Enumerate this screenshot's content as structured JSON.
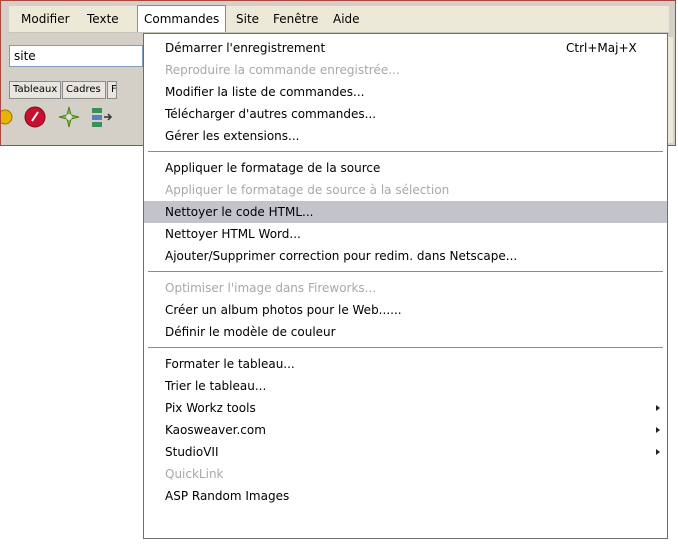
{
  "menubar": {
    "items": [
      {
        "label": "Modifier"
      },
      {
        "label": "Texte"
      },
      {
        "label": "Commandes"
      },
      {
        "label": "Site"
      },
      {
        "label": "Fenêtre"
      },
      {
        "label": "Aide"
      }
    ]
  },
  "site_selector": {
    "value": "site"
  },
  "panel_tabs": [
    {
      "label": "Tableaux"
    },
    {
      "label": "Cadres"
    },
    {
      "label": "F"
    }
  ],
  "colors": {
    "menu_selected_bg": "#c3c3cc",
    "disabled_text": "#a8a8a8",
    "frame_border": "#b0453d"
  },
  "commands_menu": {
    "items": [
      {
        "label": "Démarrer l'enregistrement",
        "shortcut": "Ctrl+Maj+X"
      },
      {
        "label": "Reproduire la commande enregistrée...",
        "disabled": true
      },
      {
        "label": "Modifier la liste de commandes..."
      },
      {
        "label": "Télécharger d'autres commandes..."
      },
      {
        "label": "Gérer les extensions..."
      },
      {
        "separator": true
      },
      {
        "label": "Appliquer le formatage de la source"
      },
      {
        "label": "Appliquer le formatage de source à la sélection",
        "disabled": true
      },
      {
        "label": "Nettoyer le code HTML...",
        "selected": true
      },
      {
        "label": "Nettoyer HTML Word..."
      },
      {
        "label": "Ajouter/Supprimer correction pour redim. dans Netscape..."
      },
      {
        "separator": true
      },
      {
        "label": "Optimiser l'image dans Fireworks...",
        "disabled": true
      },
      {
        "label": "Créer un album photos pour le Web......"
      },
      {
        "label": "Définir le modèle de couleur"
      },
      {
        "separator": true
      },
      {
        "label": "Formater le tableau..."
      },
      {
        "label": "Trier le tableau..."
      },
      {
        "label": "Pix Workz tools",
        "submenu": true
      },
      {
        "label": "Kaosweaver.com",
        "submenu": true
      },
      {
        "label": "StudioVII",
        "submenu": true
      },
      {
        "label": "QuickLink",
        "disabled": true
      },
      {
        "label": "ASP Random Images"
      }
    ]
  }
}
